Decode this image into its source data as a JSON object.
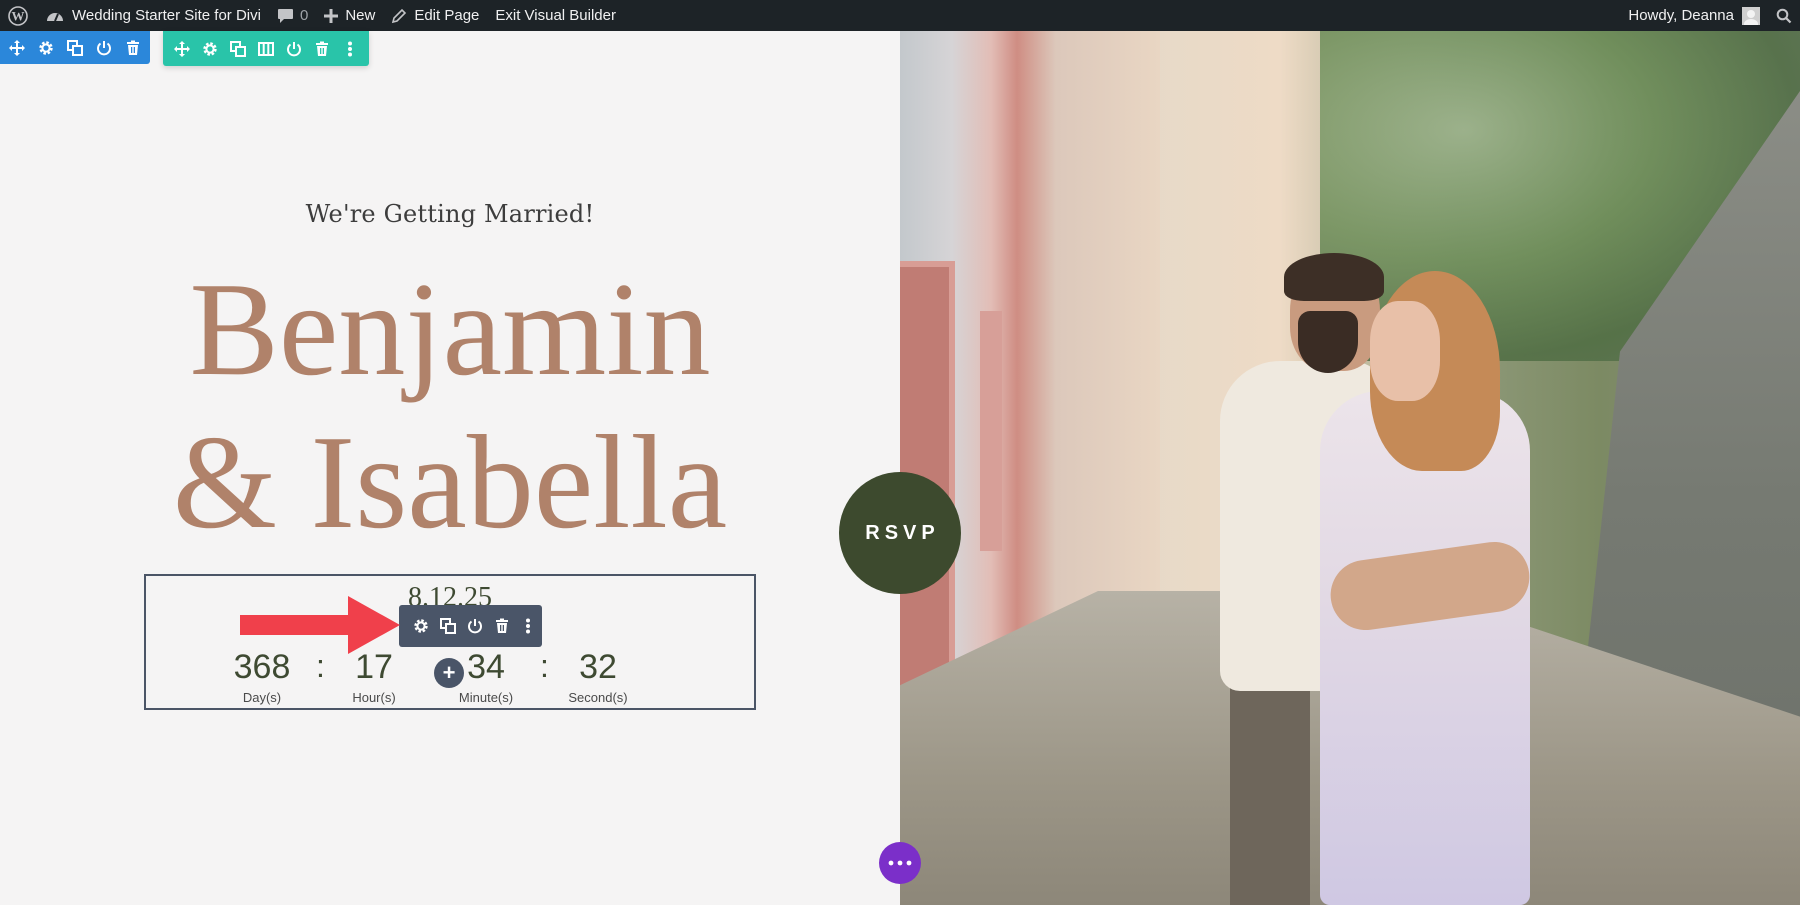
{
  "adminbar": {
    "site_name": "Wedding Starter Site for Divi",
    "comments_count": "0",
    "new_label": "New",
    "edit_page_label": "Edit Page",
    "exit_builder_label": "Exit Visual Builder",
    "greeting": "Howdy, Deanna"
  },
  "section_toolbar": {
    "buttons": [
      "move-icon",
      "gear-icon",
      "duplicate-icon",
      "power-icon",
      "trash-icon"
    ],
    "color": "#2b87da"
  },
  "row_toolbar": {
    "buttons": [
      "move-icon",
      "gear-icon",
      "duplicate-icon",
      "columns-icon",
      "power-icon",
      "trash-icon",
      "more-vertical-icon"
    ],
    "color": "#29c4a9"
  },
  "hero": {
    "subtitle": "We're Getting Married!",
    "name_line1": "Benjamin",
    "name_line2": "& Isabella",
    "name_color": "#b0826a"
  },
  "countdown": {
    "date": "8.12.25",
    "units": [
      {
        "value": "368",
        "label": "Day(s)"
      },
      {
        "value": "17",
        "label": "Hour(s)"
      },
      {
        "value": "34",
        "label": "Minute(s)"
      },
      {
        "value": "32",
        "label": "Second(s)"
      }
    ],
    "separator": ":"
  },
  "module_toolbar": {
    "buttons": [
      "gear-icon",
      "duplicate-icon",
      "power-icon",
      "trash-icon",
      "more-vertical-icon"
    ],
    "color": "#4a5568"
  },
  "add_module_symbol": "+",
  "rsvp_label": "RSVP",
  "rsvp_color": "#3d4a2e",
  "page_settings_color": "#7b2fc9",
  "arrow_color": "#f0404b"
}
